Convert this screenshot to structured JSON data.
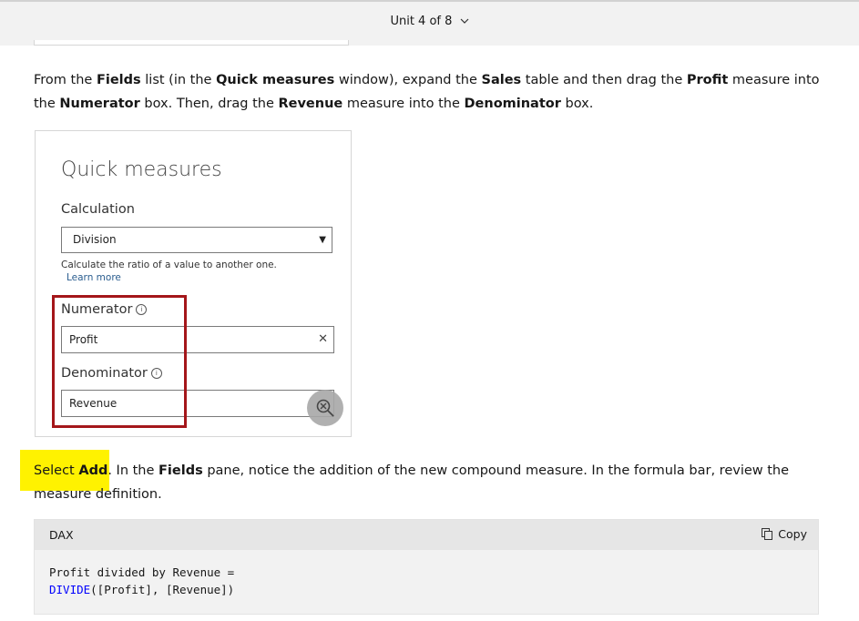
{
  "header": {
    "unit_label": "Unit 4 of 8"
  },
  "intro": {
    "t1": "From the ",
    "b1": "Fields",
    "t2": " list (in the ",
    "b2": "Quick measures",
    "t3": " window), expand the ",
    "b3": "Sales",
    "t4": " table and then drag the ",
    "b4": "Profit",
    "t5": " measure into the ",
    "b5": "Numerator",
    "t6": " box. Then, drag the ",
    "b6": "Revenue",
    "t7": " measure into the ",
    "b7": "Denominator",
    "t8": " box."
  },
  "quick_measures": {
    "title": "Quick measures",
    "calculation_label": "Calculation",
    "calculation_value": "Division",
    "help_text": "Calculate the ratio of a value to another one.",
    "learn_more": "Learn more",
    "numerator_label": "Numerator",
    "numerator_value": "Profit",
    "denominator_label": "Denominator",
    "denominator_value": "Revenue"
  },
  "step": {
    "t1": "Select ",
    "b1": "Add",
    "t2": ". In the ",
    "b2": "Fields",
    "t3": " pane, notice the addition of the new compound measure. In the formula bar, review the measure definition."
  },
  "code": {
    "language": "DAX",
    "copy_label": "Copy",
    "line1": "Profit divided by Revenue =",
    "fn": "DIVIDE",
    "line2_rest": "([Profit], [Revenue])"
  },
  "colors": {
    "highlight": "#fff200",
    "red_box": "#a4161a",
    "keyword": "#0101fd"
  }
}
